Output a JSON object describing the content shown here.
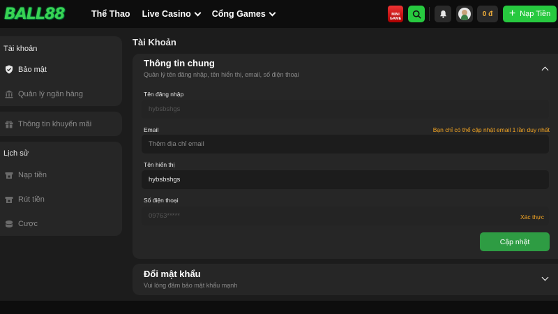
{
  "header": {
    "logo_text_1": "BALL",
    "logo_text_2": "88",
    "nav": [
      {
        "label": "Thể Thao"
      },
      {
        "label": "Live Casino"
      },
      {
        "label": "Cổng Games"
      }
    ],
    "mini_game_label": "MINI GAME",
    "balance": "0 đ",
    "deposit_label": "Nạp Tiền",
    "colors": {
      "accent": "#27c93f",
      "balance": "#f5b23c"
    }
  },
  "sidebar": {
    "account_title": "Tài khoản",
    "account_items": [
      {
        "label": "Bảo mật",
        "icon": "shield-check-icon",
        "active": true
      },
      {
        "label": "Quản lý ngân hàng",
        "icon": "bank-icon",
        "active": false
      }
    ],
    "promo_item": {
      "label": "Thông tin khuyến mãi",
      "icon": "gift-icon"
    },
    "history_title": "Lịch sử",
    "history_items": [
      {
        "label": "Nạp tiền",
        "icon": "deposit-icon"
      },
      {
        "label": "Rút tiền",
        "icon": "withdraw-icon"
      },
      {
        "label": "Cược",
        "icon": "coins-icon"
      }
    ]
  },
  "main": {
    "page_title": "Tài Khoản",
    "general": {
      "title": "Thông tin chung",
      "subtitle": "Quản lý tên đăng nhập, tên hiển thị, email, số điện thoại",
      "username_label": "Tên đăng nhập",
      "username_value": "hybsbshgs",
      "email_label": "Email",
      "email_note": "Bạn chỉ có thể cập nhật email 1 lần duy nhất",
      "email_placeholder": "Thêm địa chỉ email",
      "display_label": "Tên hiển thị",
      "display_value": "hybsbshgs",
      "phone_label": "Số điện thoại",
      "phone_value": "09763*****",
      "verify_label": "Xác thực",
      "update_label": "Cập nhật"
    },
    "password": {
      "title": "Đổi mật khẩu",
      "subtitle": "Vui lòng đảm bảo mật khẩu mạnh"
    }
  }
}
